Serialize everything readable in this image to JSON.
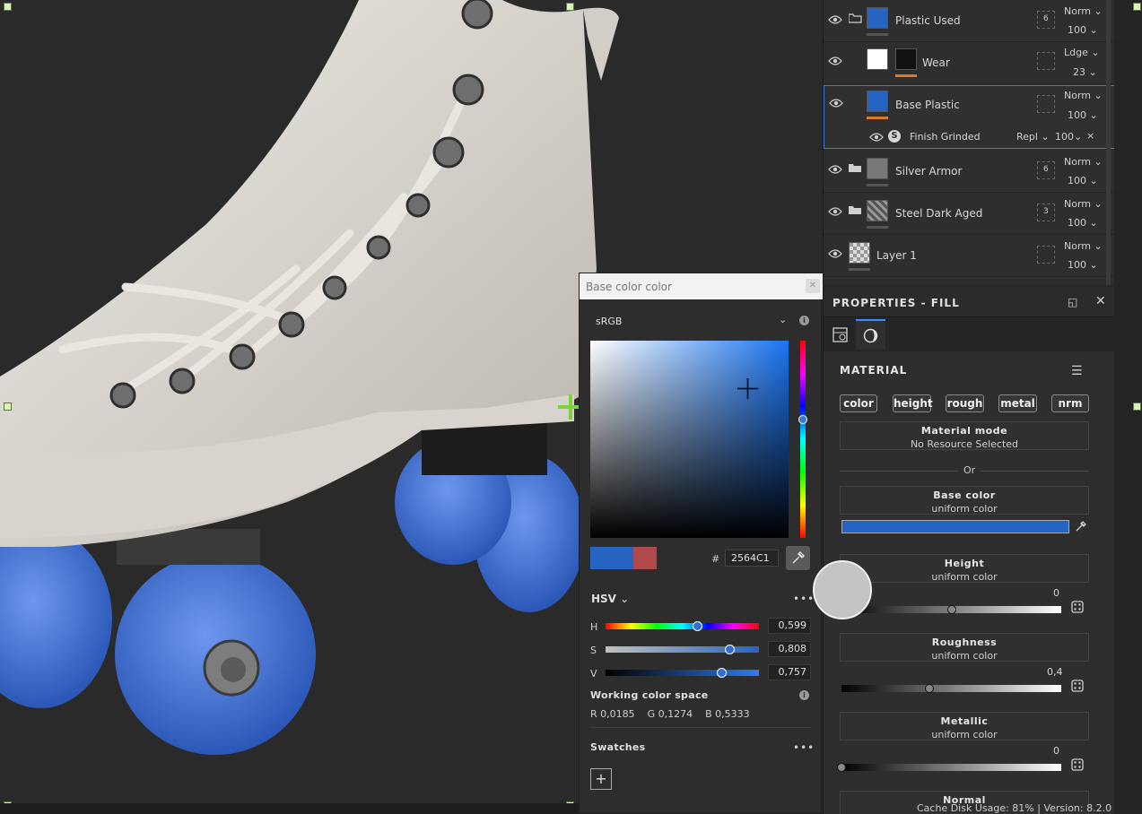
{
  "layers": [
    {
      "name": "Plastic Used",
      "blend": "Norm",
      "opacity": "100",
      "count": "6",
      "type": "folder"
    },
    {
      "name": "Wear",
      "blend": "Ldge",
      "opacity": "23",
      "type": "fill"
    },
    {
      "name": "Base Plastic",
      "blend": "Norm",
      "opacity": "100",
      "type": "fill",
      "selected": true,
      "effect": {
        "name": "Finish Grinded",
        "blend": "Repl",
        "opacity": "100"
      }
    },
    {
      "name": "Silver Armor",
      "blend": "Norm",
      "opacity": "100",
      "count": "6",
      "type": "folder"
    },
    {
      "name": "Steel Dark Aged",
      "blend": "Norm",
      "opacity": "100",
      "count": "3",
      "type": "folder"
    },
    {
      "name": "Layer 1",
      "blend": "Norm",
      "opacity": "100",
      "type": "paint"
    }
  ],
  "properties": {
    "title": "PROPERTIES - FILL",
    "section": "MATERIAL",
    "channels": [
      "color",
      "height",
      "rough",
      "metal",
      "nrm"
    ],
    "material_mode": {
      "title": "Material mode",
      "value": "No Resource Selected"
    },
    "or_label": "Or",
    "base_color": {
      "title": "Base color",
      "value": "uniform color",
      "hex": "#2564C1"
    },
    "height": {
      "title": "Height",
      "value": "uniform color",
      "num": "0",
      "level": 0.5
    },
    "roughness": {
      "title": "Roughness",
      "value": "uniform color",
      "num": "0,4",
      "level": 0.4
    },
    "metallic": {
      "title": "Metallic",
      "value": "uniform color",
      "num": "0",
      "level": 0.0
    },
    "normal": {
      "title": "Normal"
    }
  },
  "color_picker": {
    "title": "Base color color",
    "color_space": "sRGB",
    "hex": "2564C1",
    "mode": "HSV",
    "h_label": "H",
    "h": "0,599",
    "s_label": "S",
    "s": "0,808",
    "v_label": "V",
    "v": "0,757",
    "working_space_title": "Working color space",
    "working_rgb": "R 0,0185    G 0,1274    B 0,5333",
    "swatches_title": "Swatches",
    "add_label": "+"
  },
  "status": {
    "cache": "Cache Disk Usage:  81% | Version: 8.2.0"
  },
  "colors": {
    "accent": "#3b7bd6",
    "base_color": "#2564C1",
    "previous_color": "#b04a4a",
    "orange": "#e07a25"
  }
}
